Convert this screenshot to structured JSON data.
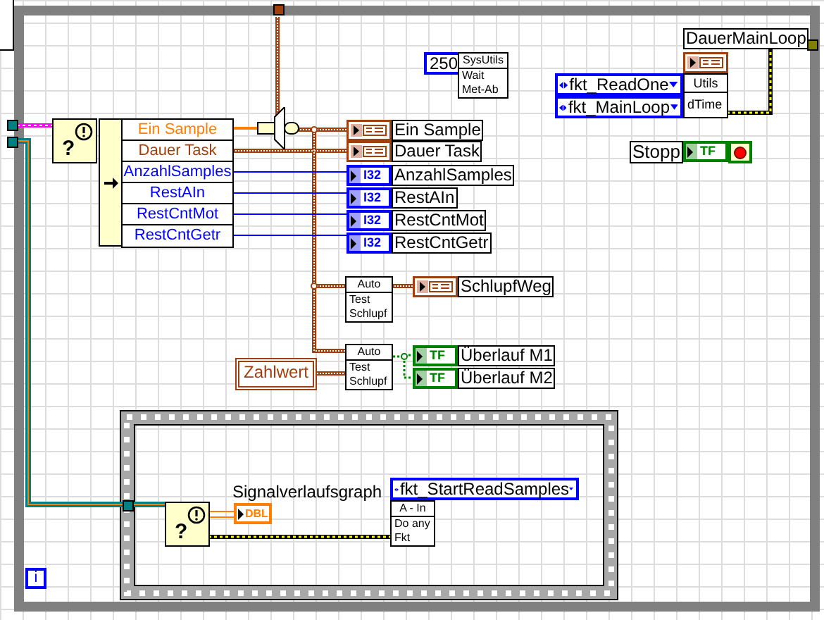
{
  "wait": {
    "constant": "250",
    "subvi": [
      "SysUtils",
      "Wait",
      "Met-Ab"
    ]
  },
  "timing": {
    "indicator": "DauerMainLoop",
    "enums": [
      "fkt_ReadOne",
      "fkt_MainLoop"
    ],
    "subvi": [
      "Utils",
      "dTime"
    ]
  },
  "stop": {
    "label": "Stopp",
    "type": "TF"
  },
  "error_cases": [
    {
      "symbol": "?"
    },
    {
      "symbol": "?"
    }
  ],
  "unbundle": [
    {
      "label": "Ein Sample",
      "color": "#ff8000"
    },
    {
      "label": "Dauer Task",
      "color": "#a0400f"
    },
    {
      "label": "AnzahlSamples",
      "color": "#0000ff"
    },
    {
      "label": "RestAIn",
      "color": "#0000ff"
    },
    {
      "label": "RestCntMot",
      "color": "#0000ff"
    },
    {
      "label": "RestCntGetr",
      "color": "#0000ff"
    }
  ],
  "indicators": [
    {
      "kind": "time",
      "label": "Ein Sample"
    },
    {
      "kind": "time",
      "label": "Dauer Task"
    },
    {
      "kind": "i32",
      "type": "I32",
      "label": "AnzahlSamples"
    },
    {
      "kind": "i32",
      "type": "I32",
      "label": "RestAIn"
    },
    {
      "kind": "i32",
      "type": "I32",
      "label": "RestCntMot"
    },
    {
      "kind": "i32",
      "type": "I32",
      "label": "RestCntGetr"
    }
  ],
  "schlupf": {
    "subvis": [
      [
        "Auto",
        "Test",
        "Schlupf"
      ],
      [
        "Auto",
        "Test",
        "Schlupf"
      ]
    ],
    "constant": "Zahlwert",
    "outputs": [
      {
        "kind": "time",
        "label": "SchlupfWeg"
      },
      {
        "kind": "bool",
        "type": "TF",
        "label": "Überlauf M1"
      },
      {
        "kind": "bool",
        "type": "TF",
        "label": "Überlauf M2"
      }
    ]
  },
  "sequence": {
    "graph_label": "Signalverlaufsgraph",
    "graph_type": "DBL",
    "enum": "fkt_StartReadSamples",
    "subvi": [
      "A - In",
      "Do any",
      "Fkt"
    ]
  },
  "loop": {
    "iteration": "i"
  }
}
